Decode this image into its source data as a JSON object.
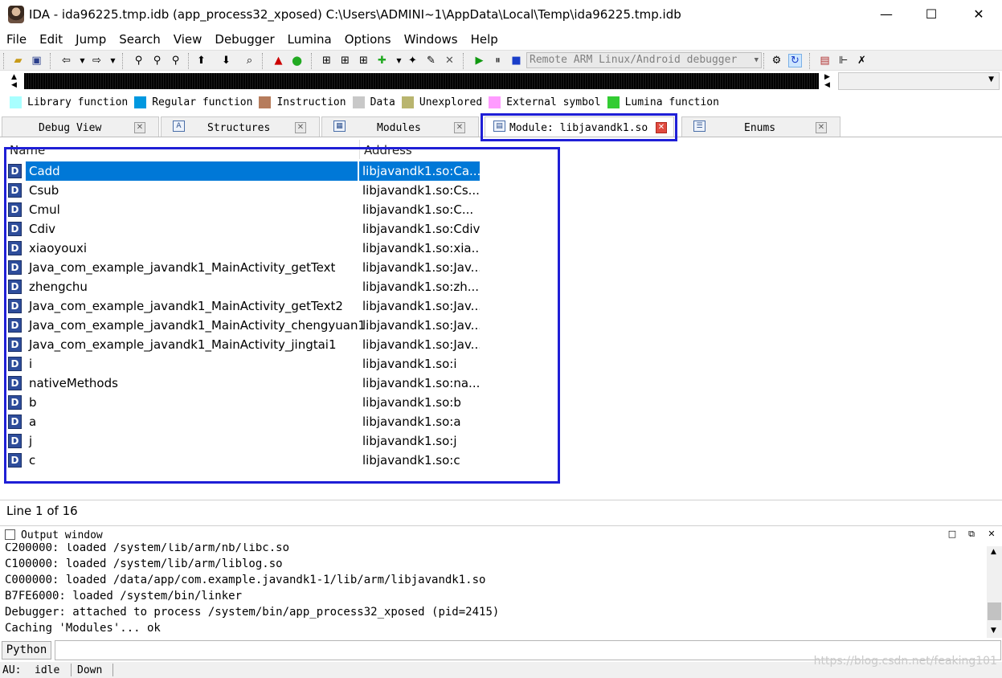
{
  "window": {
    "title": "IDA - ida96225.tmp.idb (app_process32_xposed) C:\\Users\\ADMINI~1\\AppData\\Local\\Temp\\ida96225.tmp.idb",
    "minimize_glyph": "—",
    "maximize_glyph": "☐",
    "close_glyph": "✕"
  },
  "menu": [
    "File",
    "Edit",
    "Jump",
    "Search",
    "View",
    "Debugger",
    "Lumina",
    "Options",
    "Windows",
    "Help"
  ],
  "toolbar": {
    "debugger_select": "Remote ARM Linux/Android debugger"
  },
  "legend": [
    {
      "label": "Library function",
      "color": "#a8ffff"
    },
    {
      "label": "Regular function",
      "color": "#0098e0"
    },
    {
      "label": "Instruction",
      "color": "#b67c5c"
    },
    {
      "label": "Data",
      "color": "#c8c8c8"
    },
    {
      "label": "Unexplored",
      "color": "#b9b56f"
    },
    {
      "label": "External symbol",
      "color": "#ff9bff"
    },
    {
      "label": "Lumina function",
      "color": "#33cc33"
    }
  ],
  "tabs": [
    {
      "label": "Debug View",
      "icon": ""
    },
    {
      "label": "Structures",
      "icon": "A"
    },
    {
      "label": "Modules",
      "icon": "▦"
    },
    {
      "label": "Module: libjavandk1.so",
      "icon": "▤"
    },
    {
      "label": "Enums",
      "icon": "☰"
    }
  ],
  "list": {
    "columns": [
      "Name",
      "Address"
    ],
    "icon_letter": "D",
    "rows": [
      {
        "name": "Cadd",
        "addr": "libjavandk1.so:Ca..."
      },
      {
        "name": "Csub",
        "addr": "libjavandk1.so:Cs..."
      },
      {
        "name": "Cmul",
        "addr": "libjavandk1.so:C..."
      },
      {
        "name": "Cdiv",
        "addr": "libjavandk1.so:Cdiv"
      },
      {
        "name": "xiaoyouxi",
        "addr": "libjavandk1.so:xia..."
      },
      {
        "name": "Java_com_example_javandk1_MainActivity_getText",
        "addr": "libjavandk1.so:Jav..."
      },
      {
        "name": "zhengchu",
        "addr": "libjavandk1.so:zh..."
      },
      {
        "name": "Java_com_example_javandk1_MainActivity_getText2",
        "addr": "libjavandk1.so:Jav..."
      },
      {
        "name": "Java_com_example_javandk1_MainActivity_chengyuan1",
        "addr": "libjavandk1.so:Jav..."
      },
      {
        "name": "Java_com_example_javandk1_MainActivity_jingtai1",
        "addr": "libjavandk1.so:Jav..."
      },
      {
        "name": "i",
        "addr": "libjavandk1.so:i"
      },
      {
        "name": "nativeMethods",
        "addr": "libjavandk1.so:na..."
      },
      {
        "name": "b",
        "addr": "libjavandk1.so:b"
      },
      {
        "name": "a",
        "addr": "libjavandk1.so:a"
      },
      {
        "name": "j",
        "addr": "libjavandk1.so:j"
      },
      {
        "name": "c",
        "addr": "libjavandk1.so:c"
      }
    ]
  },
  "line_status": "Line 1 of 16",
  "output": {
    "title": "Output window",
    "lines": [
      "C200000: loaded /system/lib/arm/nb/libc.so",
      "C100000: loaded /system/lib/arm/liblog.so",
      "C000000: loaded /data/app/com.example.javandk1-1/lib/arm/libjavandk1.so",
      "B7FE6000: loaded /system/bin/linker",
      "Debugger: attached to process /system/bin/app_process32_xposed (pid=2415)",
      "Caching 'Modules'... ok"
    ]
  },
  "python_button": "Python",
  "statusbar": {
    "au": "AU:",
    "state": "idle",
    "direction": "Down"
  },
  "watermark": "https://blog.csdn.net/feaking101"
}
